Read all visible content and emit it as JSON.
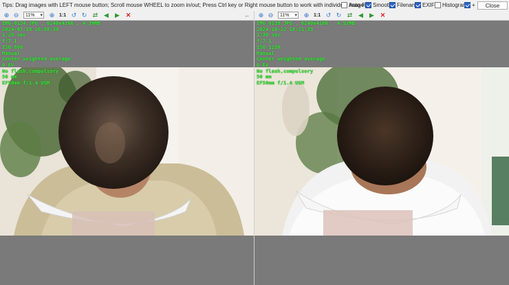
{
  "topbar": {
    "tips": "Tips: Drag images with LEFT mouse button; Scroll mouse WHEEL to zoom in/out; Press Ctrl key or Right mouse button to work with individual images.",
    "options": [
      {
        "label": "Auto-Fit",
        "checked": false
      },
      {
        "label": "Smooth",
        "checked": true
      },
      {
        "label": "Filename",
        "checked": true
      },
      {
        "label": "EXIF",
        "checked": true
      },
      {
        "label": "Histogram",
        "checked": false
      },
      {
        "label": "+",
        "checked": true
      }
    ],
    "close_label": "Close"
  },
  "left_pane": {
    "zoom": "11%",
    "one_to_one": "1:1",
    "exif_lines": [
      "IMG_0134.JPG , 6240x4160 , 4.39MB",
      "2024-07-18 16:58:39",
      "1/20 sec",
      "f/7.1",
      "ISO 800",
      "Manual",
      "Center weighted average",
      "0 EV",
      "No flash,compulsory",
      "50 mm",
      "EF50mm f/1.4 USM"
    ]
  },
  "right_pane": {
    "zoom": "11%",
    "one_to_one": "1:1",
    "exif_lines": [
      "IMG_0138.JPG , 6240x4160 , 4.52MB",
      "2024-10-22 18:21:33",
      "1/30 sec",
      "f/7.1",
      "ISO 1250",
      "Manual",
      "Center weighted average",
      "0 EV",
      "No flash,compulsory",
      "50 mm",
      "EF50mm f/1.4 USM"
    ]
  },
  "icons": {
    "zoom_in": "zoom-in-icon",
    "zoom_out": "zoom-out-icon",
    "rotate": "rotate-icon",
    "flip": "flip-icon",
    "prev": "previous-image-icon",
    "next": "next-image-icon",
    "back": "back-arrow-icon",
    "close": "close-x-icon"
  },
  "colors": {
    "exif_text": "#3ee83e",
    "pane_background": "#7a7a7a",
    "checkbox_checked": "#2a63c9",
    "close_x": "#d42020",
    "back_arrow": "#2ea02e"
  }
}
